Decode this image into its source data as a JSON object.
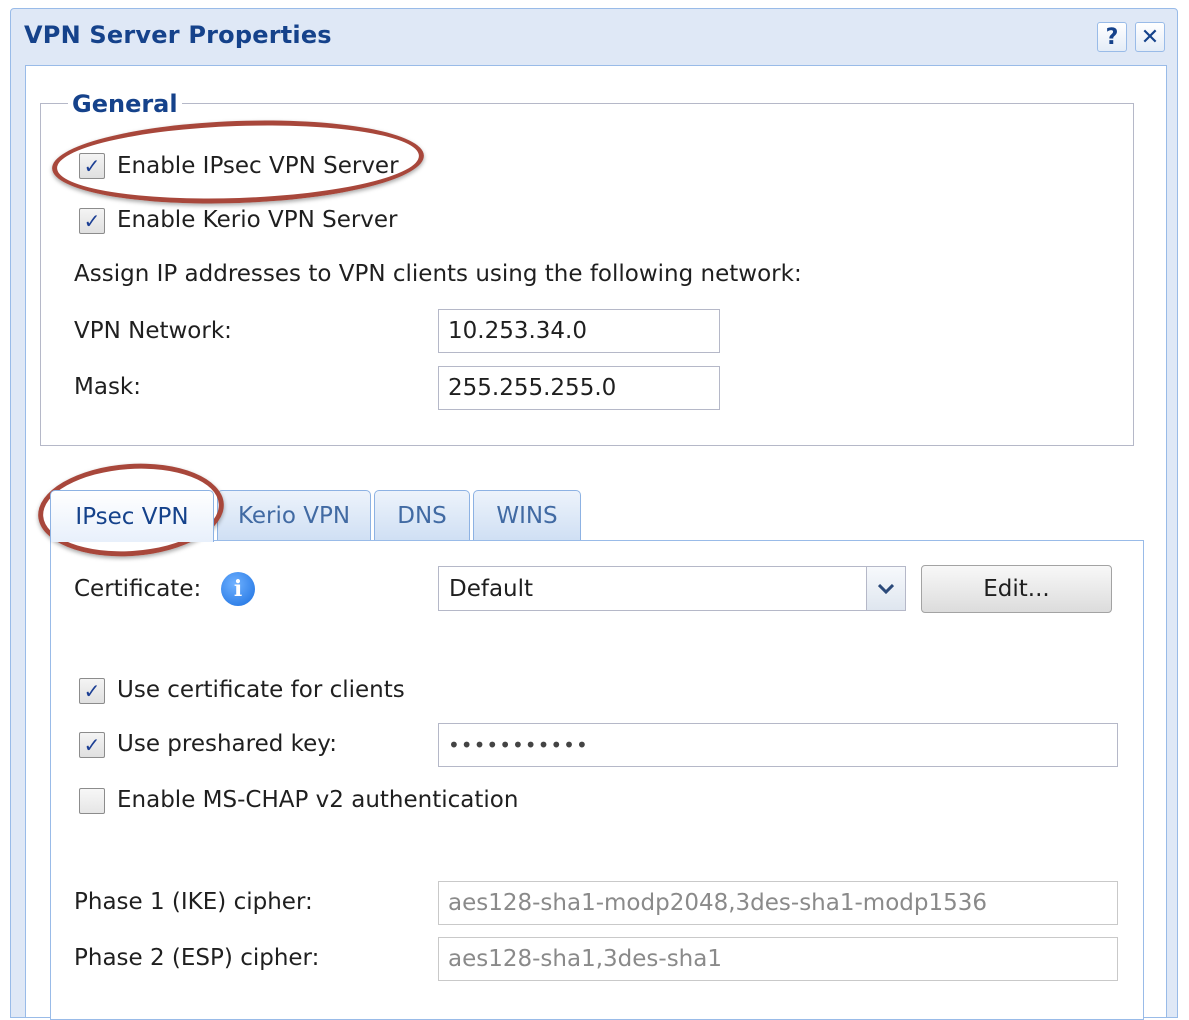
{
  "window": {
    "title": "VPN Server Properties",
    "help_glyph": "?",
    "close_glyph": "✕"
  },
  "general": {
    "legend": "General",
    "enable_ipsec": {
      "label": "Enable IPsec VPN Server",
      "checked": true
    },
    "enable_kerio": {
      "label": "Enable Kerio VPN Server",
      "checked": true
    },
    "assign_text": "Assign IP addresses to VPN clients using the following network:",
    "vpn_network": {
      "label": "VPN Network:",
      "value": "10.253.34.0"
    },
    "mask": {
      "label": "Mask:",
      "value": "255.255.255.0"
    }
  },
  "tabs": [
    {
      "label": "IPsec VPN",
      "active": true
    },
    {
      "label": "Kerio VPN",
      "active": false
    },
    {
      "label": "DNS",
      "active": false
    },
    {
      "label": "WINS",
      "active": false
    }
  ],
  "ipsec": {
    "certificate_label": "Certificate:",
    "info_glyph": "i",
    "certificate_value": "Default",
    "edit_label": "Edit...",
    "use_cert": {
      "label": "Use certificate for clients",
      "checked": true
    },
    "use_psk": {
      "label": "Use preshared key:",
      "checked": true,
      "value": "•••••••••••"
    },
    "mschap": {
      "label": "Enable MS-CHAP v2 authentication",
      "checked": false
    },
    "phase1": {
      "label": "Phase 1 (IKE) cipher:",
      "value": "aes128-sha1-modp2048,3des-sha1-modp1536"
    },
    "phase2": {
      "label": "Phase 2 (ESP) cipher:",
      "value": "aes128-sha1,3des-sha1"
    }
  },
  "annotation_color": "#a8473b",
  "accent_color": "#15428b"
}
